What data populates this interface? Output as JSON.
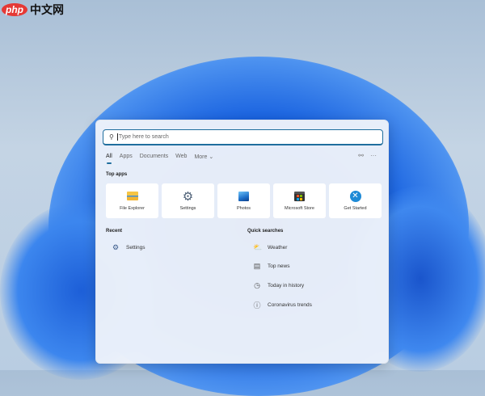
{
  "watermark": {
    "logo": "php",
    "text": "中文网"
  },
  "search": {
    "placeholder": "Type here to search"
  },
  "tabs": [
    {
      "label": "All"
    },
    {
      "label": "Apps"
    },
    {
      "label": "Documents"
    },
    {
      "label": "Web"
    },
    {
      "label": "More ⌄"
    }
  ],
  "top_apps": {
    "heading": "Top apps",
    "items": [
      {
        "label": "File Explorer"
      },
      {
        "label": "Settings"
      },
      {
        "label": "Photos"
      },
      {
        "label": "Microsoft Store"
      },
      {
        "label": "Get Started"
      }
    ]
  },
  "recent": {
    "heading": "Recent",
    "items": [
      {
        "label": "Settings"
      }
    ]
  },
  "quick": {
    "heading": "Quick searches",
    "items": [
      {
        "label": "Weather"
      },
      {
        "label": "Top news"
      },
      {
        "label": "Today in history"
      },
      {
        "label": "Coronavirus trends"
      }
    ]
  },
  "colors": {
    "accent": "#1f6e9e",
    "bloom": "#1e5fd6"
  }
}
